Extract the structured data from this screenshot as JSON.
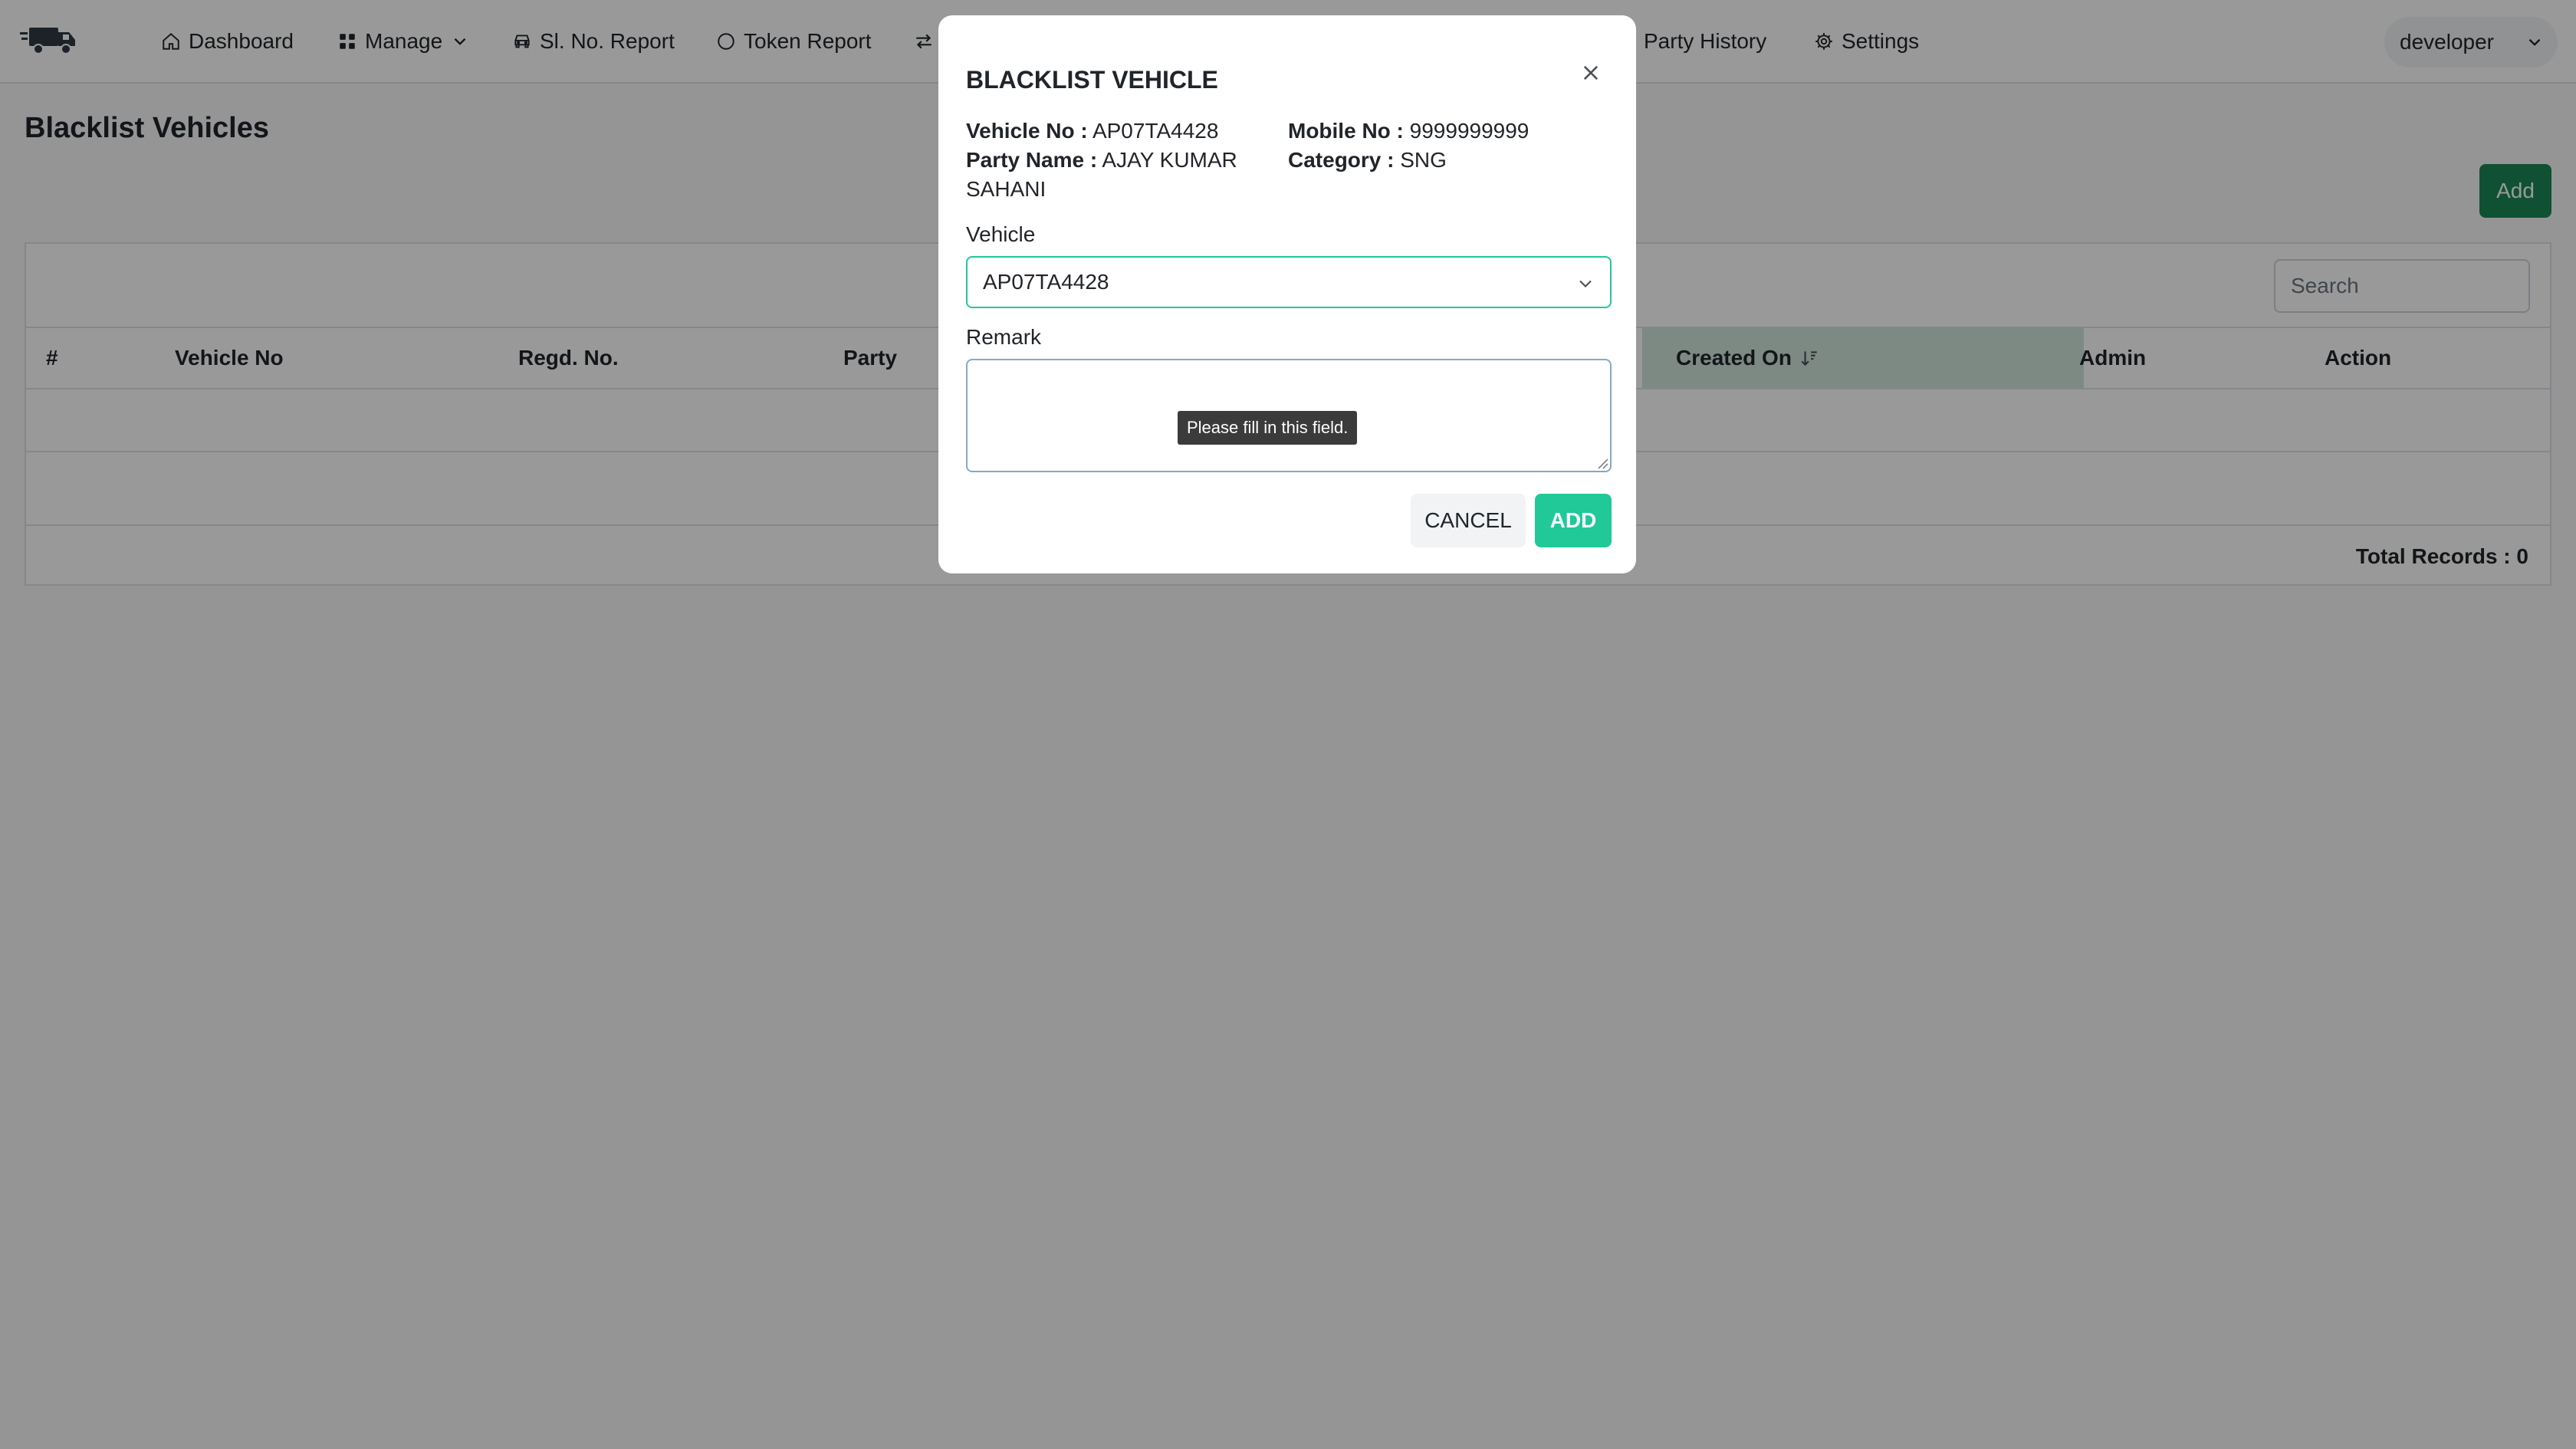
{
  "nav": {
    "items": [
      {
        "label": "Dashboard",
        "icon": "home-icon"
      },
      {
        "label": "Manage",
        "icon": "grid-icon",
        "dropdown": true
      },
      {
        "label": "Sl. No. Report",
        "icon": "car-icon"
      },
      {
        "label": "Token Report",
        "icon": "circle-icon"
      },
      {
        "label": "",
        "icon": "swap-icon"
      },
      {
        "label": "Party History",
        "icon": ""
      },
      {
        "label": "Settings",
        "icon": "gear-icon"
      }
    ],
    "user": "developer"
  },
  "page": {
    "title": "Blacklist Vehicles",
    "add_label": "Add",
    "search_placeholder": "Search",
    "columns": [
      "#",
      "Vehicle No",
      "Regd. No.",
      "Party",
      "Created On",
      "Admin",
      "Action"
    ],
    "total_records": "Total Records : 0"
  },
  "modal": {
    "title": "BLACKLIST VEHICLE",
    "vehicle_no_label": "Vehicle No :",
    "vehicle_no": "AP07TA4428",
    "party_name_label": "Party Name :",
    "party_name": "AJAY KUMAR SAHANI",
    "mobile_no_label": "Mobile No :",
    "mobile_no": "9999999999",
    "category_label": "Category :",
    "category": "SNG",
    "vehicle_field_label": "Vehicle",
    "vehicle_selected": "AP07TA4428",
    "remark_label": "Remark",
    "remark_value": "",
    "tooltip": "Please fill in this field.",
    "cancel_label": "CANCEL",
    "add_label": "ADD"
  },
  "colors": {
    "primary_green": "#198754",
    "accent_teal": "#20c997",
    "sorted_header": "#d1e7dd"
  }
}
